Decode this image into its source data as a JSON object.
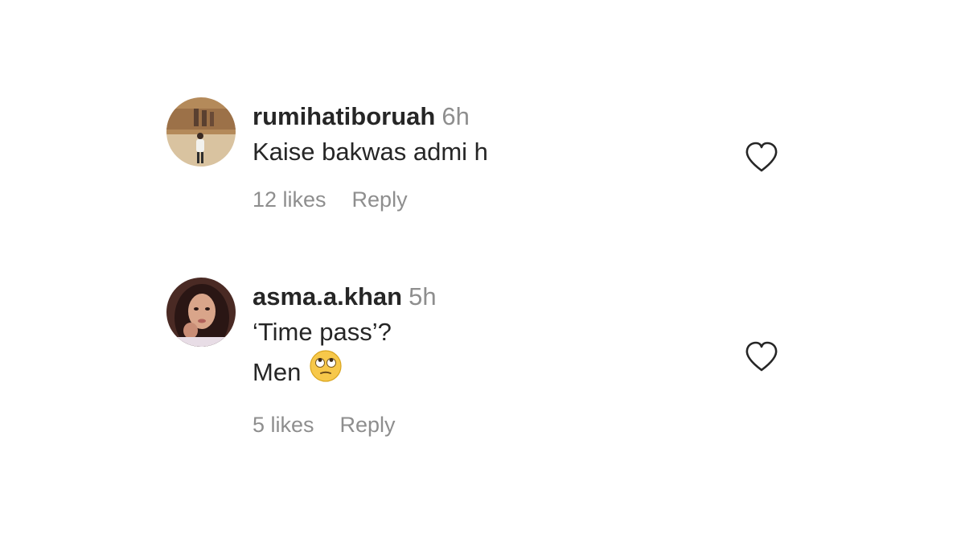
{
  "comments": [
    {
      "username": "rumihatiboruah",
      "time": "6h",
      "lines": [
        "Kaise bakwas admi h"
      ],
      "likes": "12 likes",
      "reply": "Reply"
    },
    {
      "username": "asma.a.khan",
      "time": "5h",
      "lines": [
        "‘Time pass’?",
        "Men"
      ],
      "emoji": "face-with-rolling-eyes",
      "likes": "5 likes",
      "reply": "Reply"
    }
  ],
  "icons": {
    "like": "heart-outline-icon"
  },
  "colors": {
    "text": "#262626",
    "secondary": "#8e8e8e",
    "background": "#ffffff"
  }
}
